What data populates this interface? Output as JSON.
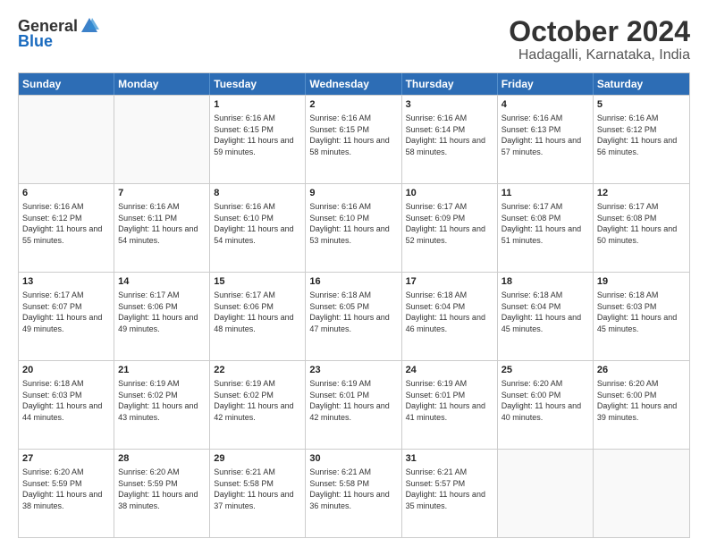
{
  "header": {
    "logo_general": "General",
    "logo_blue": "Blue",
    "month_title": "October 2024",
    "location": "Hadagalli, Karnataka, India"
  },
  "days_of_week": [
    "Sunday",
    "Monday",
    "Tuesday",
    "Wednesday",
    "Thursday",
    "Friday",
    "Saturday"
  ],
  "weeks": [
    [
      {
        "day": "",
        "empty": true
      },
      {
        "day": "",
        "empty": true
      },
      {
        "day": "1",
        "sunrise": "Sunrise: 6:16 AM",
        "sunset": "Sunset: 6:15 PM",
        "daylight": "Daylight: 11 hours and 59 minutes."
      },
      {
        "day": "2",
        "sunrise": "Sunrise: 6:16 AM",
        "sunset": "Sunset: 6:15 PM",
        "daylight": "Daylight: 11 hours and 58 minutes."
      },
      {
        "day": "3",
        "sunrise": "Sunrise: 6:16 AM",
        "sunset": "Sunset: 6:14 PM",
        "daylight": "Daylight: 11 hours and 58 minutes."
      },
      {
        "day": "4",
        "sunrise": "Sunrise: 6:16 AM",
        "sunset": "Sunset: 6:13 PM",
        "daylight": "Daylight: 11 hours and 57 minutes."
      },
      {
        "day": "5",
        "sunrise": "Sunrise: 6:16 AM",
        "sunset": "Sunset: 6:12 PM",
        "daylight": "Daylight: 11 hours and 56 minutes."
      }
    ],
    [
      {
        "day": "6",
        "sunrise": "Sunrise: 6:16 AM",
        "sunset": "Sunset: 6:12 PM",
        "daylight": "Daylight: 11 hours and 55 minutes."
      },
      {
        "day": "7",
        "sunrise": "Sunrise: 6:16 AM",
        "sunset": "Sunset: 6:11 PM",
        "daylight": "Daylight: 11 hours and 54 minutes."
      },
      {
        "day": "8",
        "sunrise": "Sunrise: 6:16 AM",
        "sunset": "Sunset: 6:10 PM",
        "daylight": "Daylight: 11 hours and 54 minutes."
      },
      {
        "day": "9",
        "sunrise": "Sunrise: 6:16 AM",
        "sunset": "Sunset: 6:10 PM",
        "daylight": "Daylight: 11 hours and 53 minutes."
      },
      {
        "day": "10",
        "sunrise": "Sunrise: 6:17 AM",
        "sunset": "Sunset: 6:09 PM",
        "daylight": "Daylight: 11 hours and 52 minutes."
      },
      {
        "day": "11",
        "sunrise": "Sunrise: 6:17 AM",
        "sunset": "Sunset: 6:08 PM",
        "daylight": "Daylight: 11 hours and 51 minutes."
      },
      {
        "day": "12",
        "sunrise": "Sunrise: 6:17 AM",
        "sunset": "Sunset: 6:08 PM",
        "daylight": "Daylight: 11 hours and 50 minutes."
      }
    ],
    [
      {
        "day": "13",
        "sunrise": "Sunrise: 6:17 AM",
        "sunset": "Sunset: 6:07 PM",
        "daylight": "Daylight: 11 hours and 49 minutes."
      },
      {
        "day": "14",
        "sunrise": "Sunrise: 6:17 AM",
        "sunset": "Sunset: 6:06 PM",
        "daylight": "Daylight: 11 hours and 49 minutes."
      },
      {
        "day": "15",
        "sunrise": "Sunrise: 6:17 AM",
        "sunset": "Sunset: 6:06 PM",
        "daylight": "Daylight: 11 hours and 48 minutes."
      },
      {
        "day": "16",
        "sunrise": "Sunrise: 6:18 AM",
        "sunset": "Sunset: 6:05 PM",
        "daylight": "Daylight: 11 hours and 47 minutes."
      },
      {
        "day": "17",
        "sunrise": "Sunrise: 6:18 AM",
        "sunset": "Sunset: 6:04 PM",
        "daylight": "Daylight: 11 hours and 46 minutes."
      },
      {
        "day": "18",
        "sunrise": "Sunrise: 6:18 AM",
        "sunset": "Sunset: 6:04 PM",
        "daylight": "Daylight: 11 hours and 45 minutes."
      },
      {
        "day": "19",
        "sunrise": "Sunrise: 6:18 AM",
        "sunset": "Sunset: 6:03 PM",
        "daylight": "Daylight: 11 hours and 45 minutes."
      }
    ],
    [
      {
        "day": "20",
        "sunrise": "Sunrise: 6:18 AM",
        "sunset": "Sunset: 6:03 PM",
        "daylight": "Daylight: 11 hours and 44 minutes."
      },
      {
        "day": "21",
        "sunrise": "Sunrise: 6:19 AM",
        "sunset": "Sunset: 6:02 PM",
        "daylight": "Daylight: 11 hours and 43 minutes."
      },
      {
        "day": "22",
        "sunrise": "Sunrise: 6:19 AM",
        "sunset": "Sunset: 6:02 PM",
        "daylight": "Daylight: 11 hours and 42 minutes."
      },
      {
        "day": "23",
        "sunrise": "Sunrise: 6:19 AM",
        "sunset": "Sunset: 6:01 PM",
        "daylight": "Daylight: 11 hours and 42 minutes."
      },
      {
        "day": "24",
        "sunrise": "Sunrise: 6:19 AM",
        "sunset": "Sunset: 6:01 PM",
        "daylight": "Daylight: 11 hours and 41 minutes."
      },
      {
        "day": "25",
        "sunrise": "Sunrise: 6:20 AM",
        "sunset": "Sunset: 6:00 PM",
        "daylight": "Daylight: 11 hours and 40 minutes."
      },
      {
        "day": "26",
        "sunrise": "Sunrise: 6:20 AM",
        "sunset": "Sunset: 6:00 PM",
        "daylight": "Daylight: 11 hours and 39 minutes."
      }
    ],
    [
      {
        "day": "27",
        "sunrise": "Sunrise: 6:20 AM",
        "sunset": "Sunset: 5:59 PM",
        "daylight": "Daylight: 11 hours and 38 minutes."
      },
      {
        "day": "28",
        "sunrise": "Sunrise: 6:20 AM",
        "sunset": "Sunset: 5:59 PM",
        "daylight": "Daylight: 11 hours and 38 minutes."
      },
      {
        "day": "29",
        "sunrise": "Sunrise: 6:21 AM",
        "sunset": "Sunset: 5:58 PM",
        "daylight": "Daylight: 11 hours and 37 minutes."
      },
      {
        "day": "30",
        "sunrise": "Sunrise: 6:21 AM",
        "sunset": "Sunset: 5:58 PM",
        "daylight": "Daylight: 11 hours and 36 minutes."
      },
      {
        "day": "31",
        "sunrise": "Sunrise: 6:21 AM",
        "sunset": "Sunset: 5:57 PM",
        "daylight": "Daylight: 11 hours and 35 minutes."
      },
      {
        "day": "",
        "empty": true
      },
      {
        "day": "",
        "empty": true
      }
    ]
  ]
}
